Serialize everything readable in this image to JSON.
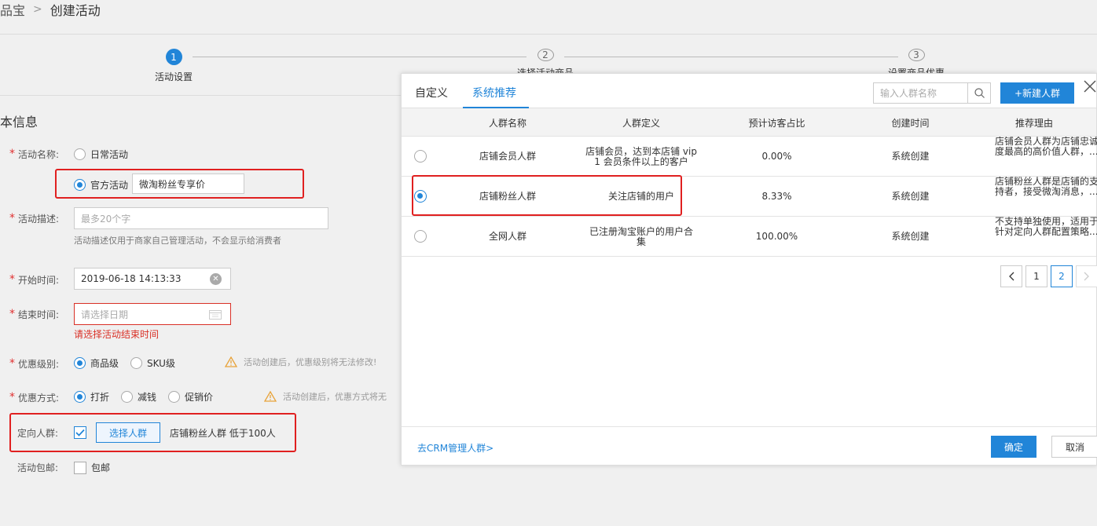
{
  "breadcrumb": {
    "parent": "品宝",
    "current": "创建活动"
  },
  "steps": [
    {
      "num": "1",
      "label": "活动设置"
    },
    {
      "num": "2",
      "label": "选择活动商品"
    },
    {
      "num": "3",
      "label": "设置商品优惠"
    }
  ],
  "form": {
    "section_title": "本信息",
    "activity_name": {
      "label": "活动名称:",
      "opt_daily": "日常活动",
      "opt_official": "官方活动",
      "official_value": "微淘粉丝专享价"
    },
    "activity_desc": {
      "label": "活动描述:",
      "placeholder": "最多20个字",
      "hint": "活动描述仅用于商家自己管理活动，不会显示给消费者"
    },
    "start_time": {
      "label": "开始时间:",
      "value": "2019-06-18 14:13:33"
    },
    "end_time": {
      "label": "结束时间:",
      "placeholder": "请选择日期",
      "error": "请选择活动结束时间"
    },
    "discount_level": {
      "label": "优惠级别:",
      "opt_item": "商品级",
      "opt_sku": "SKU级",
      "warning": "活动创建后，优惠级别将无法修改!"
    },
    "discount_type": {
      "label": "优惠方式:",
      "opt_discount": "打折",
      "opt_reduce": "减钱",
      "opt_promo": "促销价",
      "warning": "活动创建后，优惠方式将无"
    },
    "target_crowd": {
      "label": "定向人群:",
      "button": "选择人群",
      "selected": "店铺粉丝人群 低于100人"
    },
    "free_shipping": {
      "label": "活动包邮:",
      "option": "包邮"
    }
  },
  "modal": {
    "tabs": [
      "自定义",
      "系统推荐"
    ],
    "search_placeholder": "输入人群名称",
    "new_button": "+新建人群",
    "columns": [
      "人群名称",
      "人群定义",
      "预计访客占比",
      "创建时间",
      "推荐理由"
    ],
    "rows": [
      {
        "name": "店铺会员人群",
        "def1": "店铺会员，达到本店铺 vip",
        "def2": "1 会员条件以上的客户",
        "ratio": "0.00%",
        "created": "系统创建",
        "reason1": "店铺会员人群为店铺忠诚",
        "reason2": "度最高的高价值人群，...",
        "selected": false
      },
      {
        "name": "店铺粉丝人群",
        "def1": "关注店铺的用户",
        "def2": "",
        "ratio": "8.33%",
        "created": "系统创建",
        "reason1": "店铺粉丝人群是店铺的支",
        "reason2": "持者，接受微淘消息，...",
        "selected": true
      },
      {
        "name": "全网人群",
        "def1": "已注册淘宝账户的用户合",
        "def2": "集",
        "ratio": "100.00%",
        "created": "系统创建",
        "reason1": "不支持单独使用，适用于",
        "reason2": "针对定向人群配置策略...",
        "selected": false
      }
    ],
    "pages": [
      "1",
      "2"
    ],
    "crm_link": "去CRM管理人群>",
    "ok": "确定",
    "cancel": "取消"
  },
  "colors": {
    "primary": "#2185d8",
    "error": "#d93026",
    "highlight": "#e02020"
  }
}
